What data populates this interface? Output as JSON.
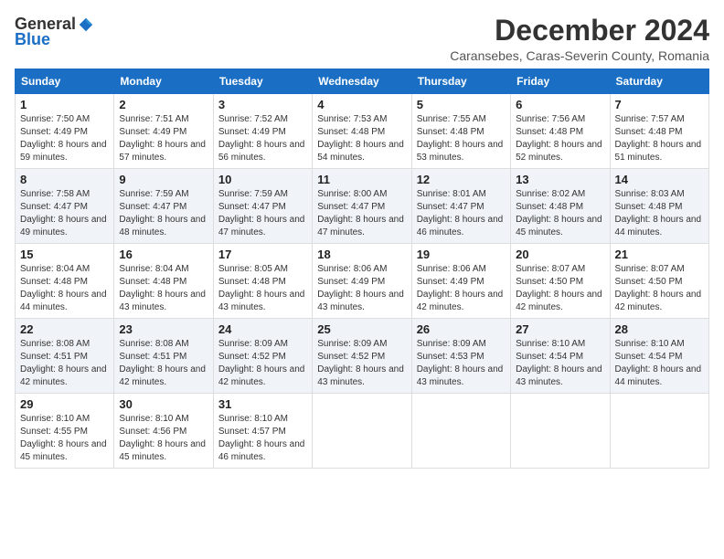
{
  "logo": {
    "general": "General",
    "blue": "Blue"
  },
  "title": "December 2024",
  "subtitle": "Caransebes, Caras-Severin County, Romania",
  "weekdays": [
    "Sunday",
    "Monday",
    "Tuesday",
    "Wednesday",
    "Thursday",
    "Friday",
    "Saturday"
  ],
  "weeks": [
    [
      {
        "day": "1",
        "sunrise": "7:50 AM",
        "sunset": "4:49 PM",
        "daylight": "8 hours and 59 minutes."
      },
      {
        "day": "2",
        "sunrise": "7:51 AM",
        "sunset": "4:49 PM",
        "daylight": "8 hours and 57 minutes."
      },
      {
        "day": "3",
        "sunrise": "7:52 AM",
        "sunset": "4:49 PM",
        "daylight": "8 hours and 56 minutes."
      },
      {
        "day": "4",
        "sunrise": "7:53 AM",
        "sunset": "4:48 PM",
        "daylight": "8 hours and 54 minutes."
      },
      {
        "day": "5",
        "sunrise": "7:55 AM",
        "sunset": "4:48 PM",
        "daylight": "8 hours and 53 minutes."
      },
      {
        "day": "6",
        "sunrise": "7:56 AM",
        "sunset": "4:48 PM",
        "daylight": "8 hours and 52 minutes."
      },
      {
        "day": "7",
        "sunrise": "7:57 AM",
        "sunset": "4:48 PM",
        "daylight": "8 hours and 51 minutes."
      }
    ],
    [
      {
        "day": "8",
        "sunrise": "7:58 AM",
        "sunset": "4:47 PM",
        "daylight": "8 hours and 49 minutes."
      },
      {
        "day": "9",
        "sunrise": "7:59 AM",
        "sunset": "4:47 PM",
        "daylight": "8 hours and 48 minutes."
      },
      {
        "day": "10",
        "sunrise": "7:59 AM",
        "sunset": "4:47 PM",
        "daylight": "8 hours and 47 minutes."
      },
      {
        "day": "11",
        "sunrise": "8:00 AM",
        "sunset": "4:47 PM",
        "daylight": "8 hours and 47 minutes."
      },
      {
        "day": "12",
        "sunrise": "8:01 AM",
        "sunset": "4:47 PM",
        "daylight": "8 hours and 46 minutes."
      },
      {
        "day": "13",
        "sunrise": "8:02 AM",
        "sunset": "4:48 PM",
        "daylight": "8 hours and 45 minutes."
      },
      {
        "day": "14",
        "sunrise": "8:03 AM",
        "sunset": "4:48 PM",
        "daylight": "8 hours and 44 minutes."
      }
    ],
    [
      {
        "day": "15",
        "sunrise": "8:04 AM",
        "sunset": "4:48 PM",
        "daylight": "8 hours and 44 minutes."
      },
      {
        "day": "16",
        "sunrise": "8:04 AM",
        "sunset": "4:48 PM",
        "daylight": "8 hours and 43 minutes."
      },
      {
        "day": "17",
        "sunrise": "8:05 AM",
        "sunset": "4:48 PM",
        "daylight": "8 hours and 43 minutes."
      },
      {
        "day": "18",
        "sunrise": "8:06 AM",
        "sunset": "4:49 PM",
        "daylight": "8 hours and 43 minutes."
      },
      {
        "day": "19",
        "sunrise": "8:06 AM",
        "sunset": "4:49 PM",
        "daylight": "8 hours and 42 minutes."
      },
      {
        "day": "20",
        "sunrise": "8:07 AM",
        "sunset": "4:50 PM",
        "daylight": "8 hours and 42 minutes."
      },
      {
        "day": "21",
        "sunrise": "8:07 AM",
        "sunset": "4:50 PM",
        "daylight": "8 hours and 42 minutes."
      }
    ],
    [
      {
        "day": "22",
        "sunrise": "8:08 AM",
        "sunset": "4:51 PM",
        "daylight": "8 hours and 42 minutes."
      },
      {
        "day": "23",
        "sunrise": "8:08 AM",
        "sunset": "4:51 PM",
        "daylight": "8 hours and 42 minutes."
      },
      {
        "day": "24",
        "sunrise": "8:09 AM",
        "sunset": "4:52 PM",
        "daylight": "8 hours and 42 minutes."
      },
      {
        "day": "25",
        "sunrise": "8:09 AM",
        "sunset": "4:52 PM",
        "daylight": "8 hours and 43 minutes."
      },
      {
        "day": "26",
        "sunrise": "8:09 AM",
        "sunset": "4:53 PM",
        "daylight": "8 hours and 43 minutes."
      },
      {
        "day": "27",
        "sunrise": "8:10 AM",
        "sunset": "4:54 PM",
        "daylight": "8 hours and 43 minutes."
      },
      {
        "day": "28",
        "sunrise": "8:10 AM",
        "sunset": "4:54 PM",
        "daylight": "8 hours and 44 minutes."
      }
    ],
    [
      {
        "day": "29",
        "sunrise": "8:10 AM",
        "sunset": "4:55 PM",
        "daylight": "8 hours and 45 minutes."
      },
      {
        "day": "30",
        "sunrise": "8:10 AM",
        "sunset": "4:56 PM",
        "daylight": "8 hours and 45 minutes."
      },
      {
        "day": "31",
        "sunrise": "8:10 AM",
        "sunset": "4:57 PM",
        "daylight": "8 hours and 46 minutes."
      },
      null,
      null,
      null,
      null
    ]
  ],
  "labels": {
    "sunrise": "Sunrise: ",
    "sunset": "Sunset: ",
    "daylight": "Daylight: "
  }
}
